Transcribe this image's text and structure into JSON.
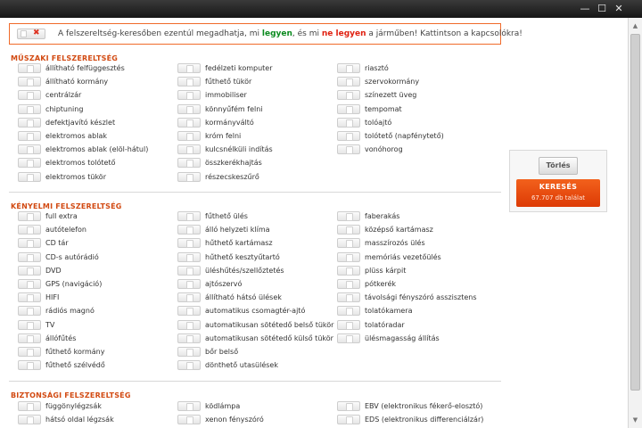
{
  "window": {
    "minimize_glyph": "—",
    "maximize_glyph": "☐",
    "close_glyph": "✕"
  },
  "notice": {
    "text_before": "A felszereltség-keresőben ezentúl megadhatja, mi",
    "positive": "legyen",
    "text_middle": ", és mi",
    "negative": "ne legyen",
    "text_after": "a járműben! Kattintson a kapcsolókra!"
  },
  "sections": {
    "muszaki": {
      "title": "MŰSZAKI FELSZERELTSÉG",
      "col1": [
        "állítható felfüggesztés",
        "állítható kormány",
        "centrálzár",
        "chiptuning",
        "defektjavító készlet",
        "elektromos ablak",
        "elektromos ablak (elöl-hátul)",
        "elektromos tolótető",
        "elektromos tükör"
      ],
      "col2": [
        "fedélzeti komputer",
        "fűthető tükör",
        "immobiliser",
        "könnyűfém felni",
        "kormányváltó",
        "króm felni",
        "kulcsnélküli indítás",
        "összkerékhajtás",
        "részecskeszűrő"
      ],
      "col3": [
        "riasztó",
        "szervokormány",
        "színezett üveg",
        "tempomat",
        "tolóajtó",
        "tolótető (napfénytető)",
        "vonóhorog"
      ]
    },
    "kenyelmi": {
      "title": "KÉNYELMI FELSZERELTSÉG",
      "col1": [
        "full extra",
        "autótelefon",
        "CD tár",
        "CD-s autórádió",
        "DVD",
        "GPS (navigáció)",
        "HIFI",
        "rádiós magnó",
        "TV",
        "állófűtés",
        "fűthető kormány",
        "fűthető szélvédő"
      ],
      "col2": [
        "fűthető ülés",
        "álló helyzeti klíma",
        "hűthető kartámasz",
        "hűthető kesztyűtartó",
        "üléshűtés/szellőztetés",
        "ajtószervó",
        "állítható hátsó ülések",
        "automatikus csomagtér-ajtó",
        "automatikusan sötétedő belső tükör",
        "automatikusan sötétedő külső tükör",
        "bőr belső",
        "dönthető utasülések"
      ],
      "col3": [
        "faberakás",
        "középső kartámasz",
        "masszírozós ülés",
        "memóriás vezetőülés",
        "plüss kárpit",
        "pótkerék",
        "távolsági fényszóró asszisztens",
        "tolatókamera",
        "tolatóradar",
        "ülésmagasság állítás"
      ]
    },
    "biztonsagi": {
      "title": "BIZTONSÁGI FELSZERELTSÉG",
      "col1": [
        "függönylégzsák",
        "hátsó oldal légzsák"
      ],
      "col2": [
        "ködlámpa",
        "xenon fényszóró"
      ],
      "col3": [
        "EBV (elektronikus fékerő-elosztó)",
        "EDS (elektronikus differenciálzár)"
      ]
    }
  },
  "panel": {
    "reset_label": "Törlés",
    "search_label": "KERESÉS",
    "results": "67.707 db találat"
  }
}
